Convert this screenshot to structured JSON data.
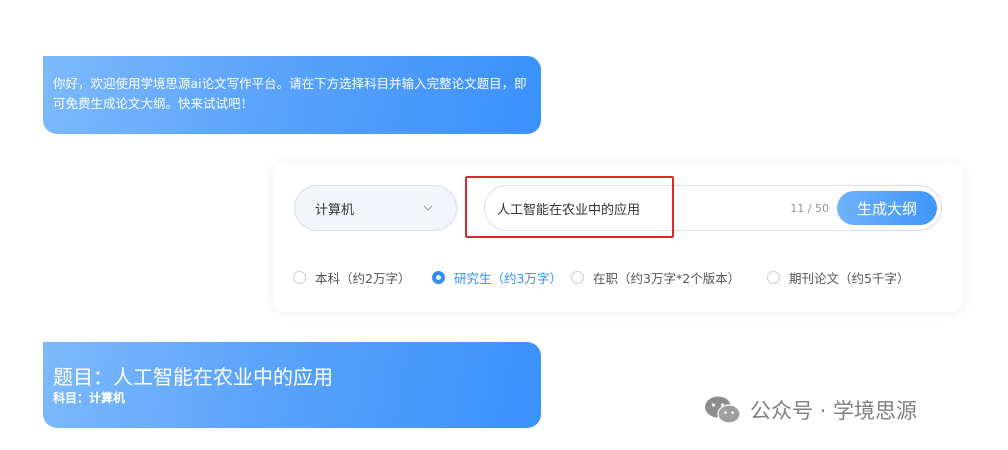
{
  "greeting": {
    "text": "你好，欢迎使用学境思源ai论文写作平台。请在下方选择科目并输入完整论文题目，即可免费生成论文大纲。快来试试吧！"
  },
  "form": {
    "subject": {
      "selected": "计算机",
      "icon": "chevron-down-icon"
    },
    "title_input": {
      "value": "人工智能在农业中的应用",
      "char_count": "11 / 50"
    },
    "generate_label": "生成大纲",
    "degree_options": [
      {
        "label": "本科（约2万字）",
        "checked": false
      },
      {
        "label": "研究生（约3万字）",
        "checked": true
      },
      {
        "label": "在职（约3万字*2个版本）",
        "checked": false
      },
      {
        "label": "期刊论文（约5千字）",
        "checked": false
      }
    ]
  },
  "result": {
    "title": "题目：人工智能在农业中的应用",
    "subject": "科目：计算机"
  },
  "watermark": {
    "text": "公众号 · 学境思源",
    "icon": "wechat-icon"
  },
  "colors": {
    "accent": "#2f8ff6",
    "highlight": "#e0282a"
  }
}
